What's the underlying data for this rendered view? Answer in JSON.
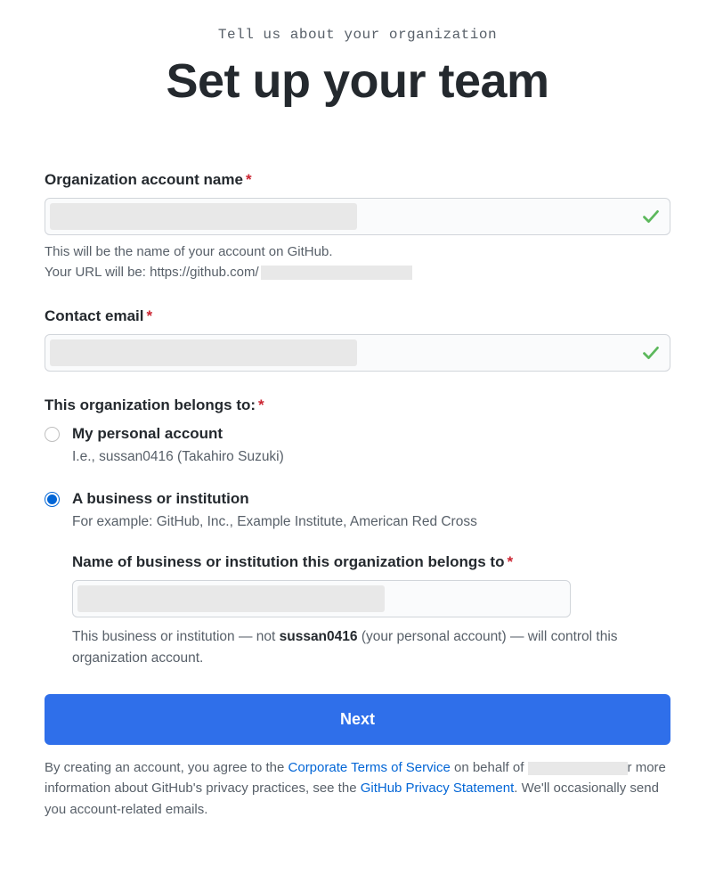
{
  "header": {
    "kicker": "Tell us about your organization",
    "title": "Set up your team"
  },
  "org_name": {
    "label": "Organization account name",
    "value": "",
    "hint_line1": "This will be the name of your account on GitHub.",
    "hint_url_prefix": "Your URL will be: https://github.com/"
  },
  "contact_email": {
    "label": "Contact email",
    "value": ""
  },
  "belongs_to": {
    "label": "This organization belongs to:",
    "options": [
      {
        "title": "My personal account",
        "desc": "I.e., sussan0416 (Takahiro Suzuki)",
        "selected": false
      },
      {
        "title": "A business or institution",
        "desc": "For example: GitHub, Inc., Example Institute, American Red Cross",
        "selected": true
      }
    ]
  },
  "business_name": {
    "label": "Name of business or institution this organization belongs to",
    "value": "",
    "hint_prefix": "This business or institution — not ",
    "hint_username": "sussan0416",
    "hint_suffix": " (your personal account) — will control this organization account."
  },
  "submit_label": "Next",
  "legal": {
    "part1": "By creating an account, you agree to the ",
    "link1": "Corporate Terms of Service",
    "part2": " on behalf of ",
    "part3": "r more information about GitHub's privacy practices, see the ",
    "link2": "GitHub Privacy Statement",
    "part4": ". We'll occasionally send you account-related emails."
  }
}
